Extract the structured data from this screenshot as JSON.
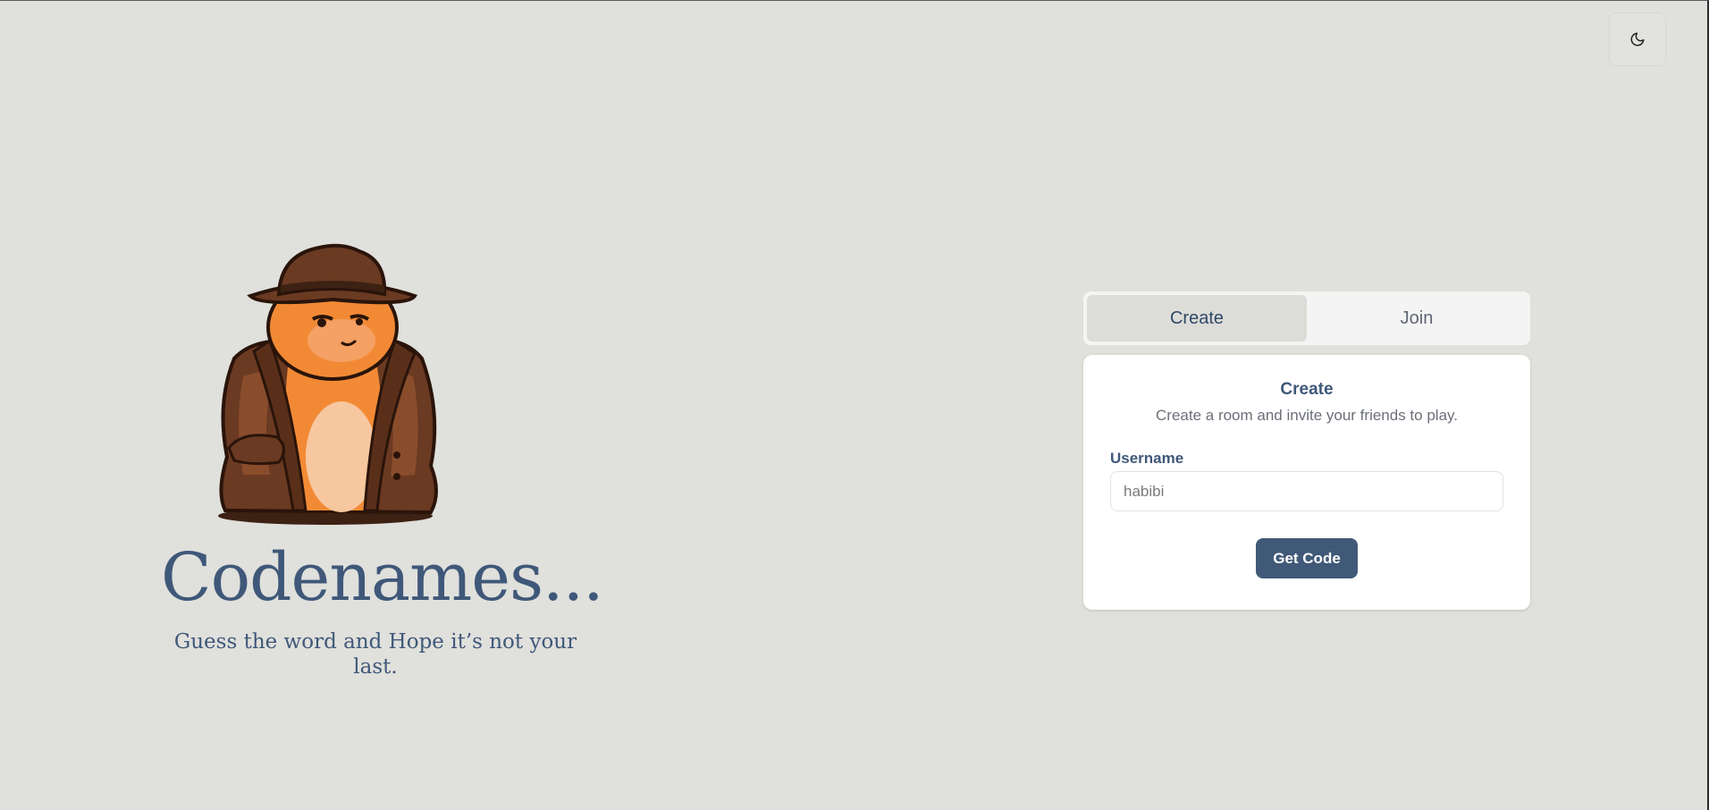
{
  "header": {
    "theme_toggle_icon": "moon-icon"
  },
  "hero": {
    "mascot_icon": "detective-hamster-icon",
    "title": "Codenames...",
    "subtitle": "Guess the word and Hope it’s not your last."
  },
  "tabs": [
    {
      "label": "Create",
      "active": true
    },
    {
      "label": "Join",
      "active": false
    }
  ],
  "card": {
    "title": "Create",
    "description": "Create a room and invite your friends to play.",
    "username_label": "Username",
    "username_placeholder": "habibi",
    "submit_label": "Get Code"
  },
  "colors": {
    "background": "#e0e0dc",
    "brand": "#3f5879",
    "button": "#405978",
    "mascot_orange": "#f28a35",
    "mascot_coat": "#6b3a22"
  }
}
